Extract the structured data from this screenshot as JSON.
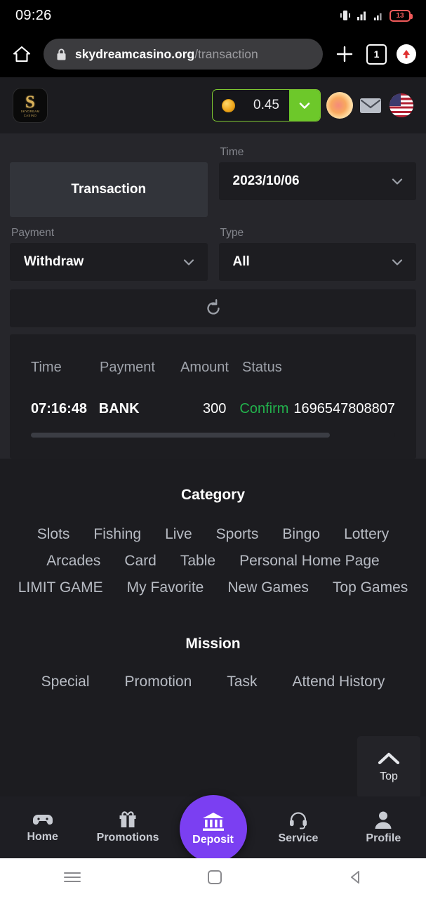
{
  "status_bar": {
    "time": "09:26",
    "battery_level": "13",
    "icons": [
      "vibrate-icon",
      "wifi-icon",
      "signal-icon",
      "battery-icon"
    ],
    "battery_color": "#f05a5a"
  },
  "browser": {
    "home_icon": "home-icon",
    "lock_icon": "lock-icon",
    "url_host": "skydreamcasino.org",
    "url_path": "/transaction",
    "new_tab_icon": "plus-icon",
    "tab_count": "1",
    "profile_icon": "profile-arrow-icon"
  },
  "app_header": {
    "logo_letter": "S",
    "logo_subtitle_line1": "SKYDREAM",
    "logo_subtitle_line2": "CASINO",
    "balance_amount": "0.45",
    "coin_icon": "coin-icon",
    "balance_expand_icon": "chevron-down-icon",
    "avatar_icon": "avatar-icon",
    "mail_icon": "mail-icon",
    "flag_icon": "us-flag-icon",
    "accent_green": "#6dc82a",
    "border_green": "#7ec832"
  },
  "filters": {
    "transaction_tab_label": "Transaction",
    "time_label": "Time",
    "time_value": "2023/10/06",
    "payment_label": "Payment",
    "payment_value": "Withdraw",
    "type_label": "Type",
    "type_value": "All",
    "dropdown_icon": "chevron-down-icon",
    "refresh_icon": "refresh-icon"
  },
  "table": {
    "columns": [
      "Time",
      "Payment",
      "Amount",
      "Status",
      ""
    ],
    "rows": [
      {
        "time": "07:16:48",
        "payment": "BANK",
        "amount": "300",
        "status": "Confirm",
        "order_id": "1696547808807",
        "status_color": "#22b14c"
      }
    ]
  },
  "footer": {
    "category_title": "Category",
    "category_links": [
      "Slots",
      "Fishing",
      "Live",
      "Sports",
      "Bingo",
      "Lottery",
      "Arcades",
      "Card",
      "Table",
      "Personal Home Page",
      "LIMIT GAME",
      "My Favorite",
      "New Games",
      "Top Games"
    ],
    "mission_title": "Mission",
    "mission_links": [
      "Special",
      "Promotion",
      "Task",
      "Attend History"
    ]
  },
  "top_button": {
    "label": "Top",
    "icon": "chevron-up-icon"
  },
  "bottom_nav": {
    "items": [
      {
        "label": "Home",
        "icon": "gamepad-icon"
      },
      {
        "label": "Promotions",
        "icon": "gift-icon"
      },
      {
        "label": "Deposit",
        "icon": "bank-icon"
      },
      {
        "label": "Service",
        "icon": "headset-icon"
      },
      {
        "label": "Profile",
        "icon": "person-icon"
      }
    ],
    "deposit_color": "#7b3ff2"
  },
  "android_nav": {
    "recents_icon": "menu-icon",
    "home_icon": "square-icon",
    "back_icon": "triangle-back-icon"
  }
}
